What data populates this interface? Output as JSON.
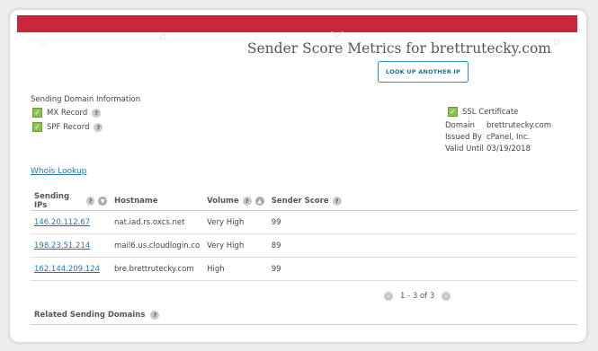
{
  "page": {
    "title": "Sender Score Metrics for brettrutecky.com",
    "lookup_button": "LOOK UP ANOTHER IP"
  },
  "domain_info": {
    "heading": "Sending Domain Information",
    "mx_label": "MX Record",
    "spf_label": "SPF Record"
  },
  "ssl": {
    "label": "SSL Certificate",
    "domain_key": "Domain",
    "domain_value": "brettrutecky.com",
    "issued_key": "Issued By",
    "issued_value": "cPanel, Inc.",
    "valid_key": "Valid Until",
    "valid_value": "03/19/2018"
  },
  "whois": "Whois Lookup",
  "table": {
    "columns": [
      "Sending IPs",
      "Hostname",
      "Volume",
      "Sender Score"
    ],
    "rows": [
      {
        "ip": "146.20.112.67",
        "hostname": "nat.iad.rs.oxcs.net",
        "volume": "Very High",
        "score": "99"
      },
      {
        "ip": "198.23.51.214",
        "hostname": "mail6.us.cloudlogin.co",
        "volume": "Very High",
        "score": "89"
      },
      {
        "ip": "162.144.209.124",
        "hostname": "bre.brettrutecky.com",
        "volume": "High",
        "score": "99"
      }
    ]
  },
  "pager": "1 - 3 of 3",
  "related": "Related Sending Domains",
  "help_glyph": "?",
  "colors": {
    "banner": "#c8273b",
    "link": "#1f7aa9",
    "check": "#8cc152"
  }
}
